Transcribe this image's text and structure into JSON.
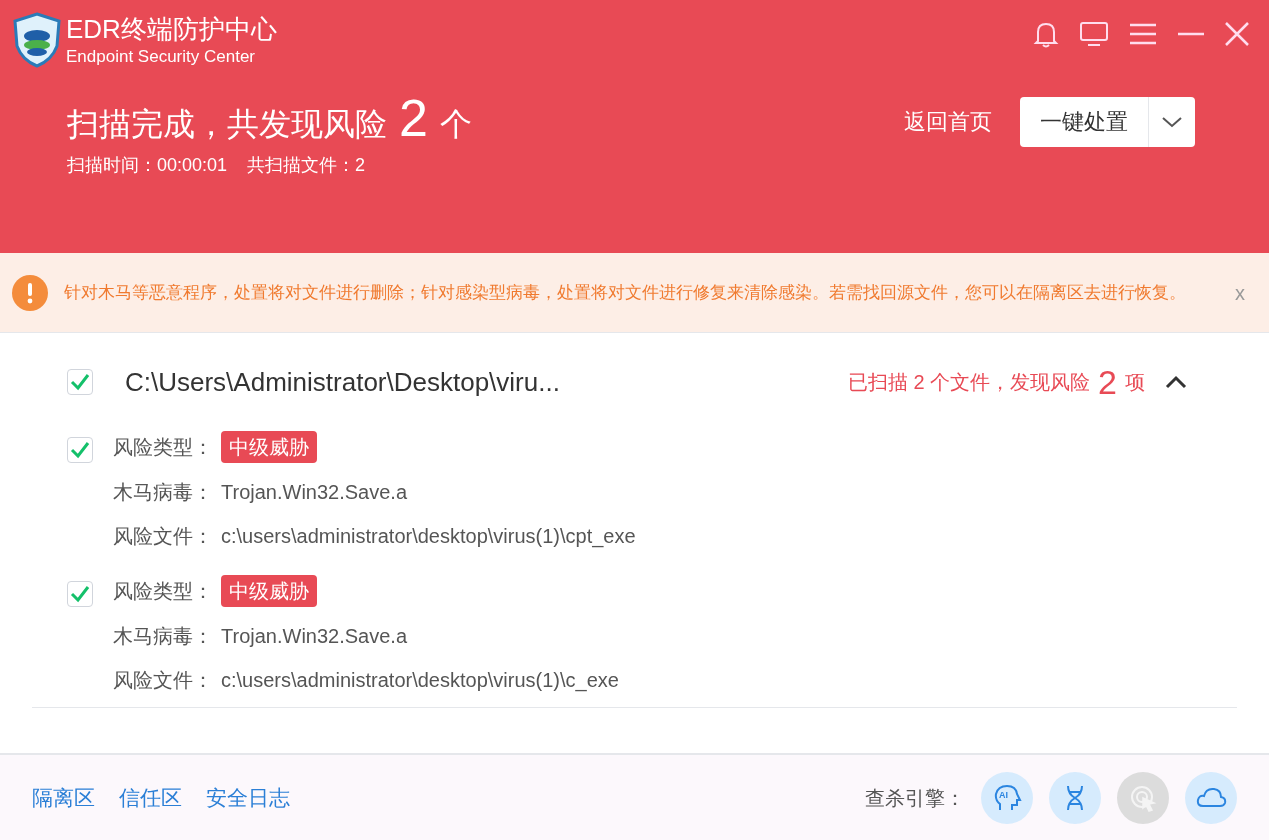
{
  "app": {
    "title": "EDR终端防护中心",
    "subtitle": "Endpoint Security Center"
  },
  "summary": {
    "title": "扫描完成，共发现风险",
    "count": "2",
    "unit": "个",
    "scan_time": "扫描时间：00:00:01",
    "scan_files": "共扫描文件：2"
  },
  "actions": {
    "home": "返回首页",
    "primary": "一键处置"
  },
  "notice": {
    "text": "针对木马等恶意程序，处置将对文件进行删除；针对感染型病毒，处置将对文件进行修复来清除感染。若需找回源文件，您可以在隔离区去进行恢复。",
    "close": "x"
  },
  "group": {
    "path": "C:\\Users\\Administrator\\Desktop\\viru...",
    "checked": true,
    "expanded": true,
    "stat_prefix": "已扫描 2 个文件，发现风险",
    "stat_count": "2",
    "stat_unit": "项",
    "items": [
      {
        "checked": true,
        "type_label": "风险类型：",
        "level": "中级威胁",
        "virus_label": "木马病毒：",
        "virus": "Trojan.Win32.Save.a",
        "file_label": "风险文件：",
        "file": "c:\\users\\administrator\\desktop\\virus(1)\\cpt_exe"
      },
      {
        "checked": true,
        "type_label": "风险类型：",
        "level": "中级威胁",
        "virus_label": "木马病毒：",
        "virus": "Trojan.Win32.Save.a",
        "file_label": "风险文件：",
        "file": "c:\\users\\administrator\\desktop\\virus(1)\\c_exe"
      }
    ]
  },
  "footer": {
    "links": [
      "隔离区",
      "信任区",
      "安全日志"
    ],
    "engines_label": "查杀引擎：",
    "engines": [
      {
        "kind": "ai",
        "enabled": true,
        "text": "AI"
      },
      {
        "kind": "dna",
        "enabled": true
      },
      {
        "kind": "behavior",
        "enabled": false
      },
      {
        "kind": "cloud",
        "enabled": true
      }
    ]
  }
}
